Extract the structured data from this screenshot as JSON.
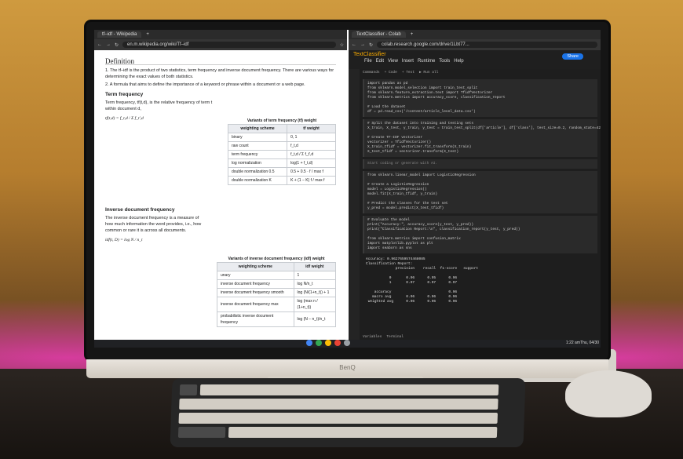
{
  "left_browser": {
    "tab_title": "tf–idf - Wikipedia",
    "url": "en.m.wikipedia.org/wiki/Tf–idf",
    "definition_heading": "Definition",
    "definition_items": [
      "1. The tf–idf is the product of two statistics, term frequency and inverse document frequency. There are various ways for determining the exact values of both statistics.",
      "2. A formula that aims to define the importance of a keyword or phrase within a document or a web page."
    ],
    "term_frequency_heading": "Term frequency",
    "term_frequency_text": "Term frequency, tf(t,d), is the relative frequency of term t within document d,",
    "tf_formula": "tf(t,d) = f_t,d / Σ f_t',d",
    "idf_heading": "Inverse document frequency",
    "idf_text": "The inverse document frequency is a measure of how much information the word provides, i.e., how common or rare it is across all documents.",
    "idf_formula": "idf(t, D) = log N / n_t",
    "tf_table_caption": "Variants of term frequency (tf) weight",
    "tf_table_head": [
      "weighting scheme",
      "tf weight"
    ],
    "tf_table_rows": [
      [
        "binary",
        "0, 1"
      ],
      [
        "raw count",
        "f_t,d"
      ],
      [
        "term frequency",
        "f_t,d / Σ f_t',d"
      ],
      [
        "log normalization",
        "log(1 + f_t,d)"
      ],
      [
        "double normalization 0.5",
        "0.5 + 0.5 · f / max f"
      ],
      [
        "double normalization K",
        "K + (1 − K) f / max f"
      ]
    ],
    "idf_table_caption": "Variants of inverse document frequency (idf) weight",
    "idf_table_head": [
      "weighting scheme",
      "idf weight"
    ],
    "idf_table_rows": [
      [
        "unary",
        "1"
      ],
      [
        "inverse document frequency",
        "log N/n_t"
      ],
      [
        "inverse document frequency smooth",
        "log (N/(1+n_t)) + 1"
      ],
      [
        "inverse document frequency max",
        "log (max n / (1+n_t))"
      ],
      [
        "probabilistic inverse document frequency",
        "log (N − n_t)/n_t"
      ]
    ]
  },
  "right_browser": {
    "tab_title": "TextClassifier - Colab",
    "url": "colab.research.google.com/drive/1Lbt77...",
    "notebook_title": "TextClassifier",
    "menu": [
      "File",
      "Edit",
      "View",
      "Insert",
      "Runtime",
      "Tools",
      "Help"
    ],
    "toolbar": [
      "Commands",
      "+ Code",
      "+ Text",
      "▶ Run all"
    ],
    "share_label": "Share",
    "cells": [
      "import pandas as pd\nfrom sklearn.model_selection import train_test_split\nfrom sklearn.feature_extraction.text import TfidfVectorizer\nfrom sklearn.metrics import accuracy_score, classification_report\n\n# Load the dataset\ndf = pd.read_csv('/content/article_level_data.csv')",
      "# Split the dataset into training and testing sets\nX_train, X_test, y_train, y_test = train_test_split(df['article'], df['class'], test_size=0.2, random_state=42)\n\n# Create TF-IDF vectorizer\nvectorizer = TfidfVectorizer()\nX_train_tfidf = vectorizer.fit_transform(X_train)\nX_test_tfidf = vectorizer.transform(X_test)",
      "Start coding or generate with AI.",
      "from sklearn.linear_model import LogisticRegression\n\n# Create a LogisticRegression\nmodel = LogisticRegression()\nmodel.fit(X_train_tfidf, y_train)\n\n# Predict the classes for the test set\ny_pred = model.predict(X_test_tfidf)",
      "# Evaluate the model\nprint(\"Accuracy:\", accuracy_score(y_test, y_pred))\nprint(\"Classification Report:\\n\", classification_report(y_test, y_pred))\n\nfrom sklearn.metrics import confusion_matrix\nimport matplotlib.pyplot as plt\nimport seaborn as sns"
    ],
    "output": "Accuracy: 0.9627659574468085\nClassification Report:\n              precision    recall  f1-score   support\n\n           0       0.96      0.95      0.96\n           1       0.97      0.97      0.97\n\n    accuracy                           0.96\n   macro avg       0.96      0.96      0.96\n weighted avg      0.96      0.96      0.96",
    "bottom_bar": [
      "Variables",
      "Terminal"
    ]
  },
  "taskbar": {
    "time": "1:22 am",
    "date": "Thu, 04/30"
  },
  "monitor_brand": "BenQ",
  "colors": {
    "wall": "#c28a37",
    "led_glow": "#ff3cc8",
    "colab_bg": "#1e1e1e",
    "wiki_bg": "#ffffff"
  }
}
